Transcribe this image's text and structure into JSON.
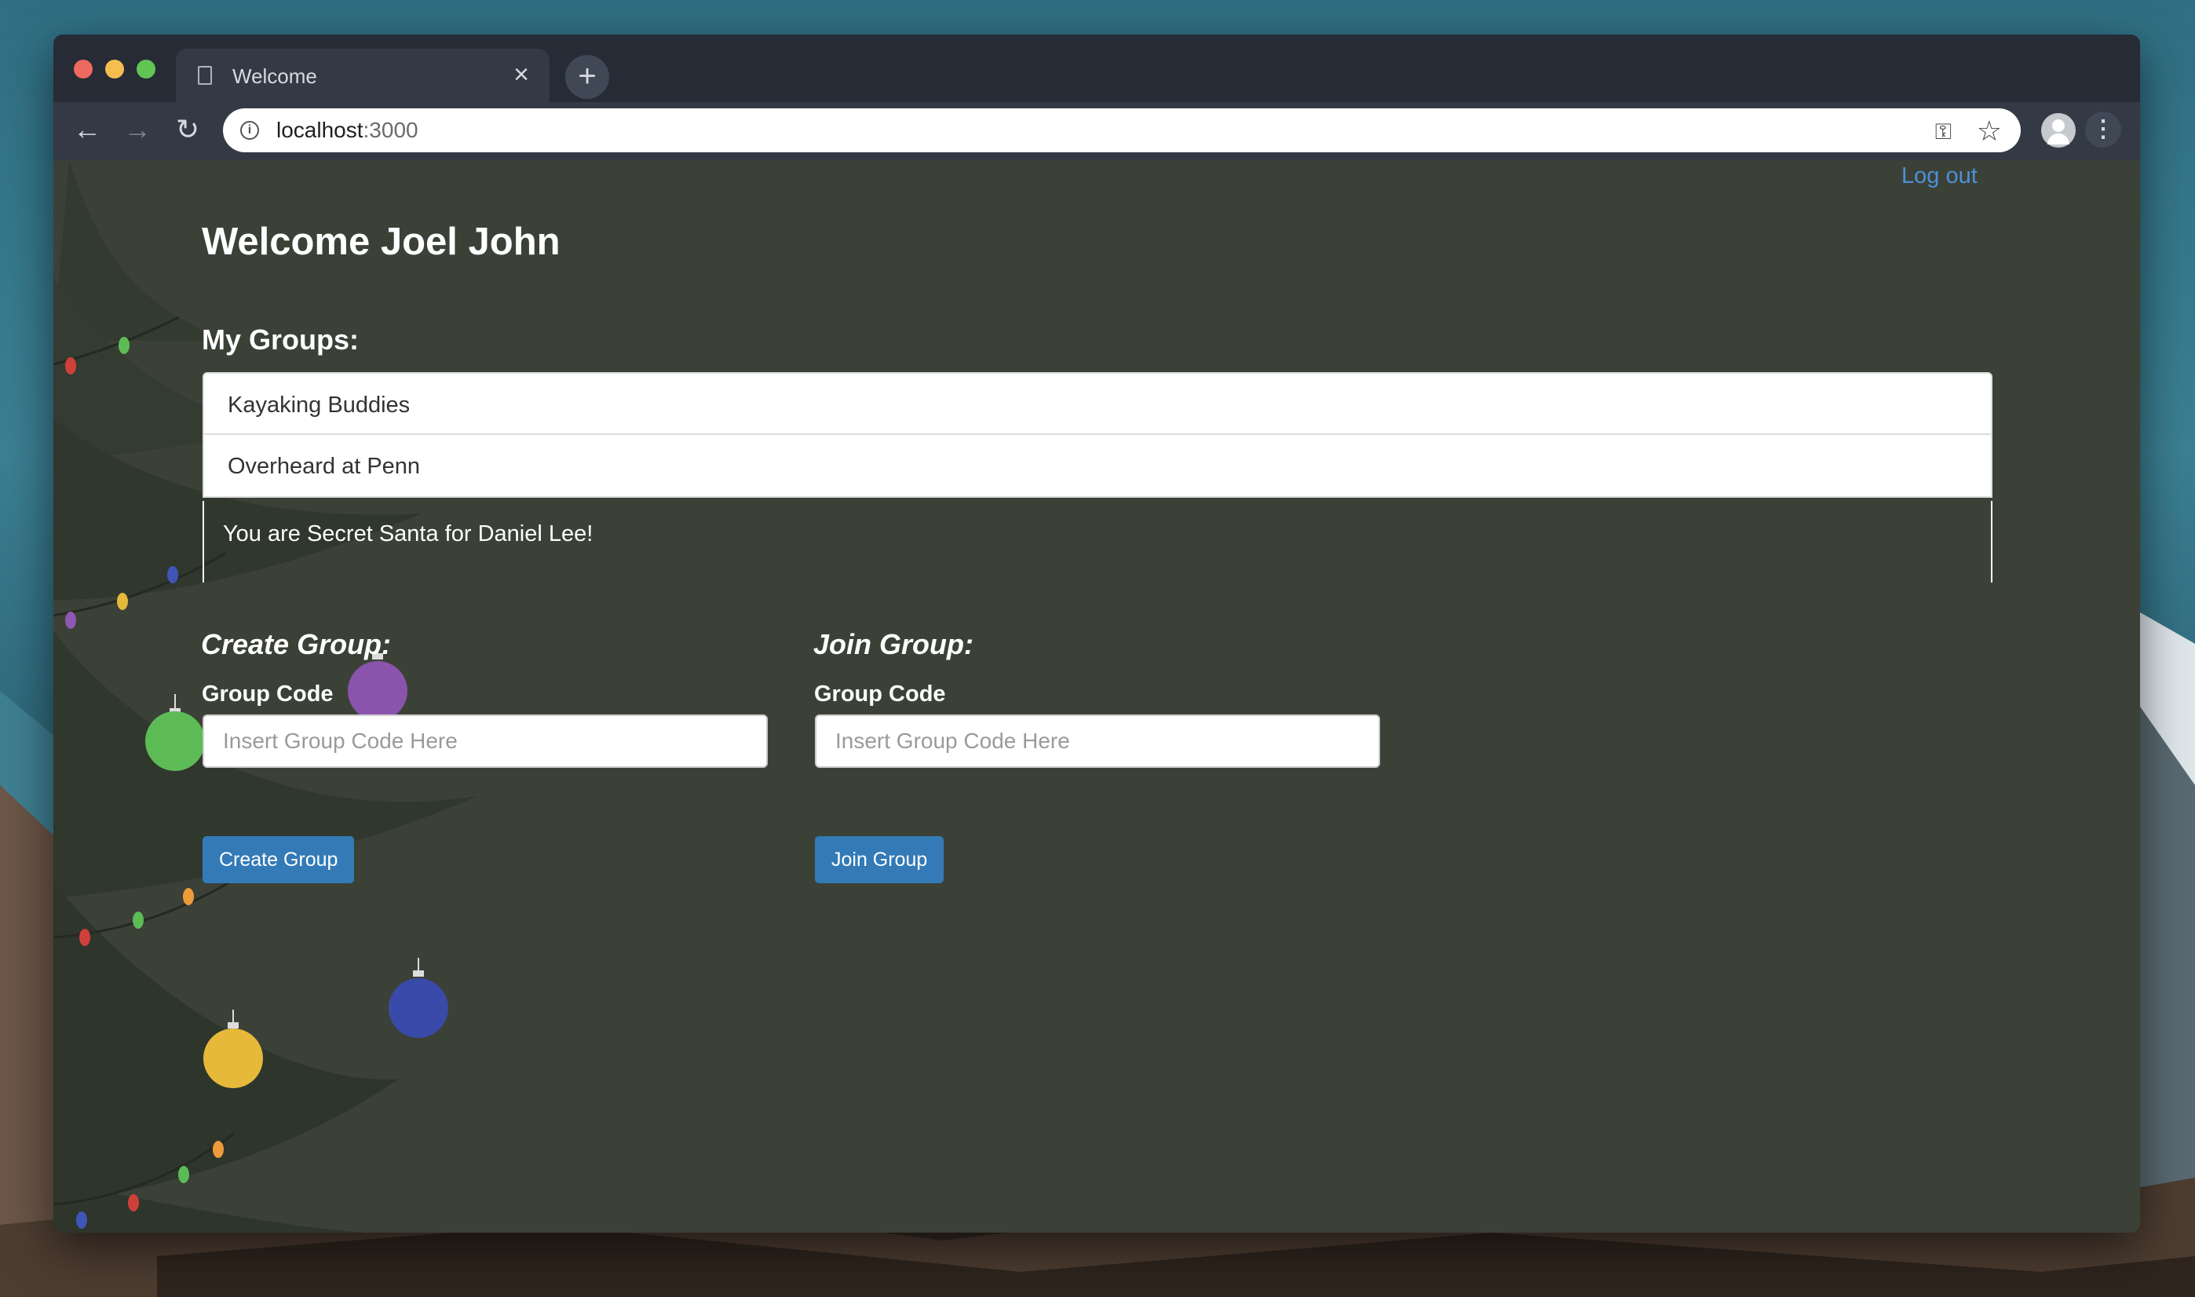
{
  "browser": {
    "tab_title": "Welcome",
    "tab_close": "×",
    "new_tab": "+",
    "url_host": "localhost",
    "url_port": ":3000"
  },
  "header": {
    "logout": "Log out",
    "welcome": "Welcome Joel John"
  },
  "groups": {
    "heading": "My Groups:",
    "items": [
      "Kayaking Buddies",
      "Overheard at Penn"
    ],
    "santa_message": "You are Secret Santa for Daniel Lee!"
  },
  "create": {
    "title": "Create Group:",
    "label": "Group Code",
    "placeholder": "Insert Group Code Here",
    "button": "Create Group"
  },
  "join": {
    "title": "Join Group:",
    "label": "Group Code",
    "placeholder": "Insert Group Code Here",
    "button": "Join Group"
  },
  "colors": {
    "page_bg": "#3b4137",
    "link": "#4e90d6",
    "button": "#337ab7"
  }
}
